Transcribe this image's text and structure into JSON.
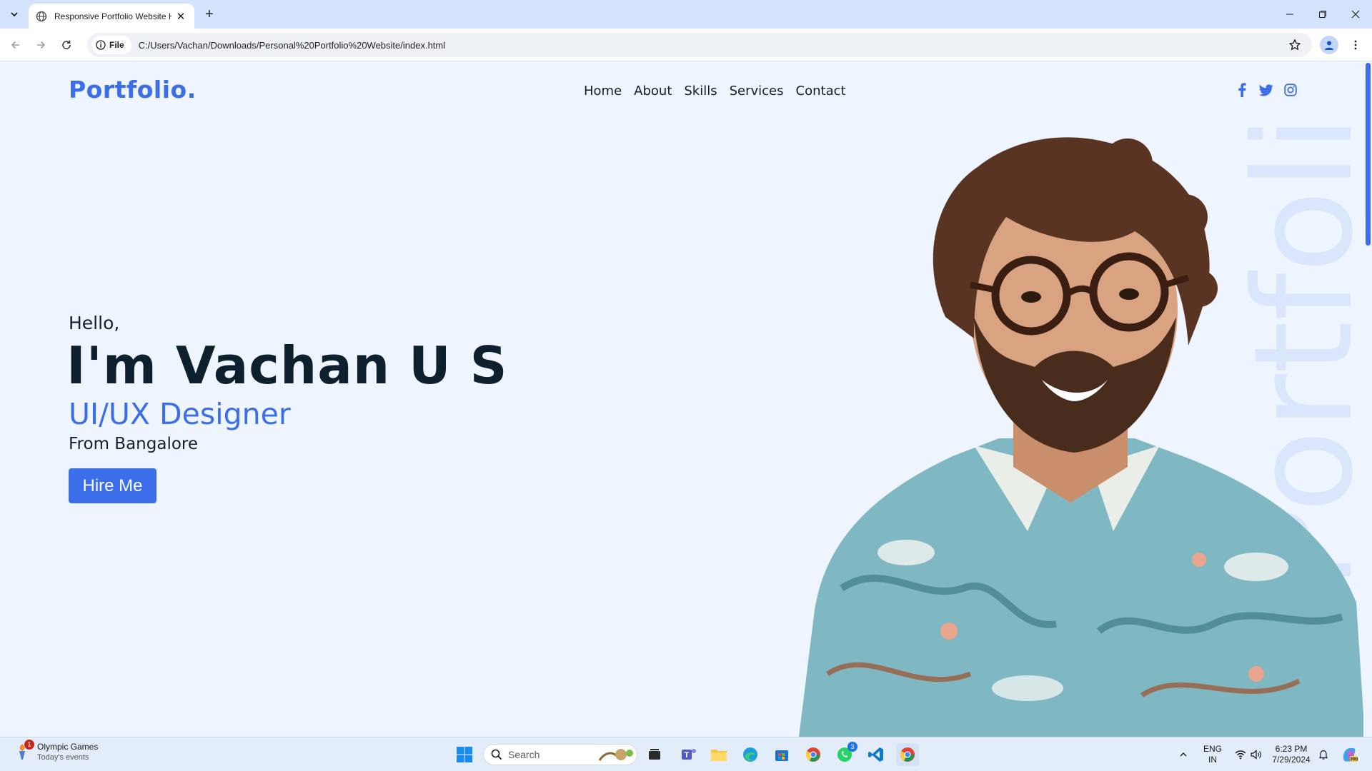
{
  "browser": {
    "tab_title": "Responsive Portfolio Website H",
    "site_chip": "File",
    "url": "C:/Users/Vachan/Downloads/Personal%20Portfolio%20Website/index.html"
  },
  "site": {
    "logo": "Portfolio.",
    "nav": [
      "Home",
      "About",
      "Skills",
      "Services",
      "Contact"
    ],
    "socials": [
      "facebook-icon",
      "twitter-icon",
      "instagram-icon"
    ],
    "accent": "#3b6ee8"
  },
  "hero": {
    "greeting": "Hello,",
    "name": "I'm Vachan U S",
    "role": "UI/UX Designer",
    "location": "From Bangalore",
    "cta": "Hire Me",
    "watermark": "Portfolio"
  },
  "taskbar": {
    "widget_title": "Olympic Games",
    "widget_sub": "Today's events",
    "widget_badge": "1",
    "search_placeholder": "Search",
    "whatsapp_badge": "3",
    "lang_top": "ENG",
    "lang_bottom": "IN",
    "time": "6:23 PM",
    "date": "7/29/2024"
  }
}
